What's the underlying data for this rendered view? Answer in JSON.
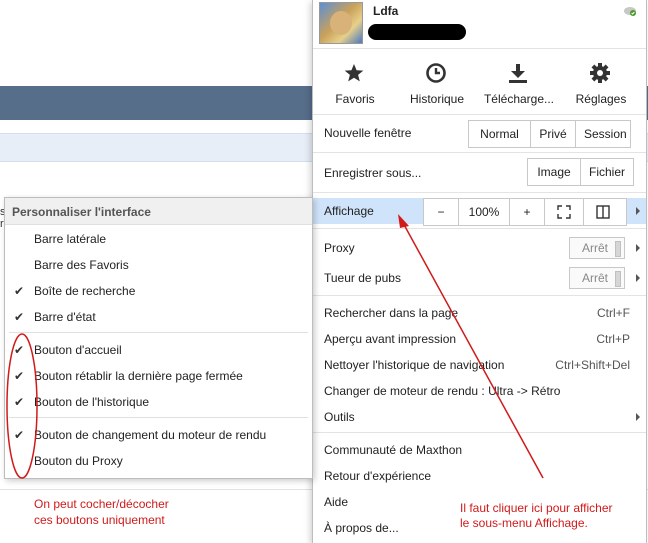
{
  "background": {
    "fragment_1": "s",
    "fragment_2": "r",
    "caption_line1": "On peut cocher/décocher",
    "caption_line2": "ces boutons uniquement"
  },
  "user": {
    "name": "Ldfa",
    "avatar_icon": "cat-avatar-icon"
  },
  "quick_access": [
    {
      "label": "Favoris",
      "icon": "star-icon"
    },
    {
      "label": "Historique",
      "icon": "clock-icon"
    },
    {
      "label": "Télécharge...",
      "icon": "download-icon"
    },
    {
      "label": "Réglages",
      "icon": "gear-icon"
    }
  ],
  "menu": {
    "new_window": {
      "label": "Nouvelle fenêtre",
      "buttons": [
        "Normal",
        "Privé",
        "Session"
      ]
    },
    "save_as": {
      "label": "Enregistrer sous...",
      "buttons": [
        "Image",
        "Fichier"
      ]
    },
    "view": {
      "label": "Affichage",
      "zoom_minus": "−",
      "zoom_value": "100%",
      "zoom_plus": "+"
    },
    "proxy": {
      "label": "Proxy",
      "state": "Arrêt"
    },
    "adblock": {
      "label": "Tueur de pubs",
      "state": "Arrêt"
    },
    "find": {
      "label": "Rechercher dans la page",
      "shortcut": "Ctrl+F"
    },
    "print_preview": {
      "label": "Aperçu avant impression",
      "shortcut": "Ctrl+P"
    },
    "clear_history": {
      "label": "Nettoyer l'historique de navigation",
      "shortcut": "Ctrl+Shift+Del"
    },
    "render_engine": {
      "label": "Changer de moteur de rendu : Ultra -> Rétro"
    },
    "tools": {
      "label": "Outils"
    },
    "community": {
      "label": "Communauté de Maxthon"
    },
    "feedback": {
      "label": "Retour d'expérience"
    },
    "help": {
      "label": "Aide"
    },
    "about": {
      "label": "À propos de..."
    }
  },
  "submenu": {
    "title": "Personnaliser l'interface",
    "items": [
      {
        "label": "Barre latérale",
        "checked": false
      },
      {
        "label": "Barre des Favoris",
        "checked": false
      },
      {
        "label": "Boîte de recherche",
        "checked": true
      },
      {
        "label": "Barre d'état",
        "checked": true
      },
      {
        "label": "Bouton d'accueil",
        "checked": true
      },
      {
        "label": "Bouton rétablir la dernière page fermée",
        "checked": true
      },
      {
        "label": "Bouton de l'historique",
        "checked": true
      },
      {
        "label": "Bouton de changement du moteur de rendu",
        "checked": true
      },
      {
        "label": "Bouton du Proxy",
        "checked": false
      }
    ],
    "check_glyph": "✔"
  },
  "annotation": {
    "line1": "Il faut cliquer ici pour afficher",
    "line2": "le sous-menu Affichage.",
    "color": "#d11a1a"
  },
  "colors": {
    "highlight": "#cfe3fa",
    "band": "#566e8a",
    "annotation": "#d11a1a"
  }
}
